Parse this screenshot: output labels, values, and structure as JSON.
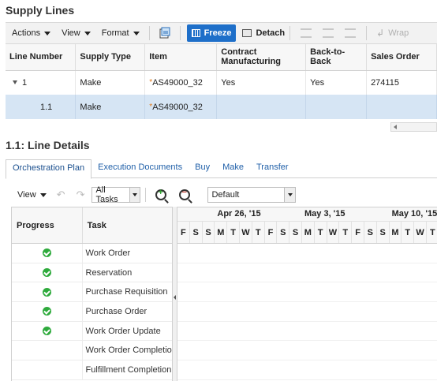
{
  "supply": {
    "title": "Supply Lines",
    "toolbar": {
      "actions": "Actions",
      "view": "View",
      "format": "Format",
      "freeze": "Freeze",
      "detach": "Detach",
      "wrap": "Wrap"
    },
    "columns": [
      "Line Number",
      "Supply Type",
      "Item",
      "Contract Manufacturing",
      "Back-to-Back",
      "Sales Order"
    ],
    "rows": [
      {
        "line": "1",
        "type": "Make",
        "item": "AS49000_32",
        "contract": "Yes",
        "b2b": "Yes",
        "so": "274115"
      },
      {
        "line": "1.1",
        "type": "Make",
        "item": "AS49000_32",
        "contract": "",
        "b2b": "",
        "so": ""
      }
    ]
  },
  "details": {
    "title": "1.1: Line Details",
    "tabs": [
      "Orchestration Plan",
      "Execution Documents",
      "Buy",
      "Make",
      "Transfer"
    ],
    "active_tab": "Orchestration Plan",
    "toolbar": {
      "view": "View",
      "task_filter": "All Tasks",
      "scale": "Default"
    },
    "grid_headers": {
      "progress": "Progress",
      "task": "Task"
    },
    "tasks": [
      {
        "name": "Work Order",
        "done": true
      },
      {
        "name": "Reservation",
        "done": true
      },
      {
        "name": "Purchase Requisition",
        "done": true
      },
      {
        "name": "Purchase Order",
        "done": true
      },
      {
        "name": "Work Order Update",
        "done": true
      },
      {
        "name": "Work Order Completion",
        "done": false
      },
      {
        "name": "Fulfillment Completion",
        "done": false
      }
    ],
    "timeline": {
      "weeks": [
        "Apr 26, '15",
        "May 3, '15",
        "May 10, '15"
      ],
      "days": [
        "F",
        "S",
        "S",
        "M",
        "T",
        "W",
        "T",
        "F",
        "S",
        "S",
        "M",
        "T",
        "W",
        "T",
        "F",
        "S",
        "S",
        "M",
        "T",
        "W",
        "T"
      ]
    }
  },
  "colors": {
    "accent": "#1e6fc9",
    "selected_row": "#d6e5f4",
    "success": "#2eaa3c",
    "link": "#1f5fa8",
    "required": "#e07a1a"
  }
}
